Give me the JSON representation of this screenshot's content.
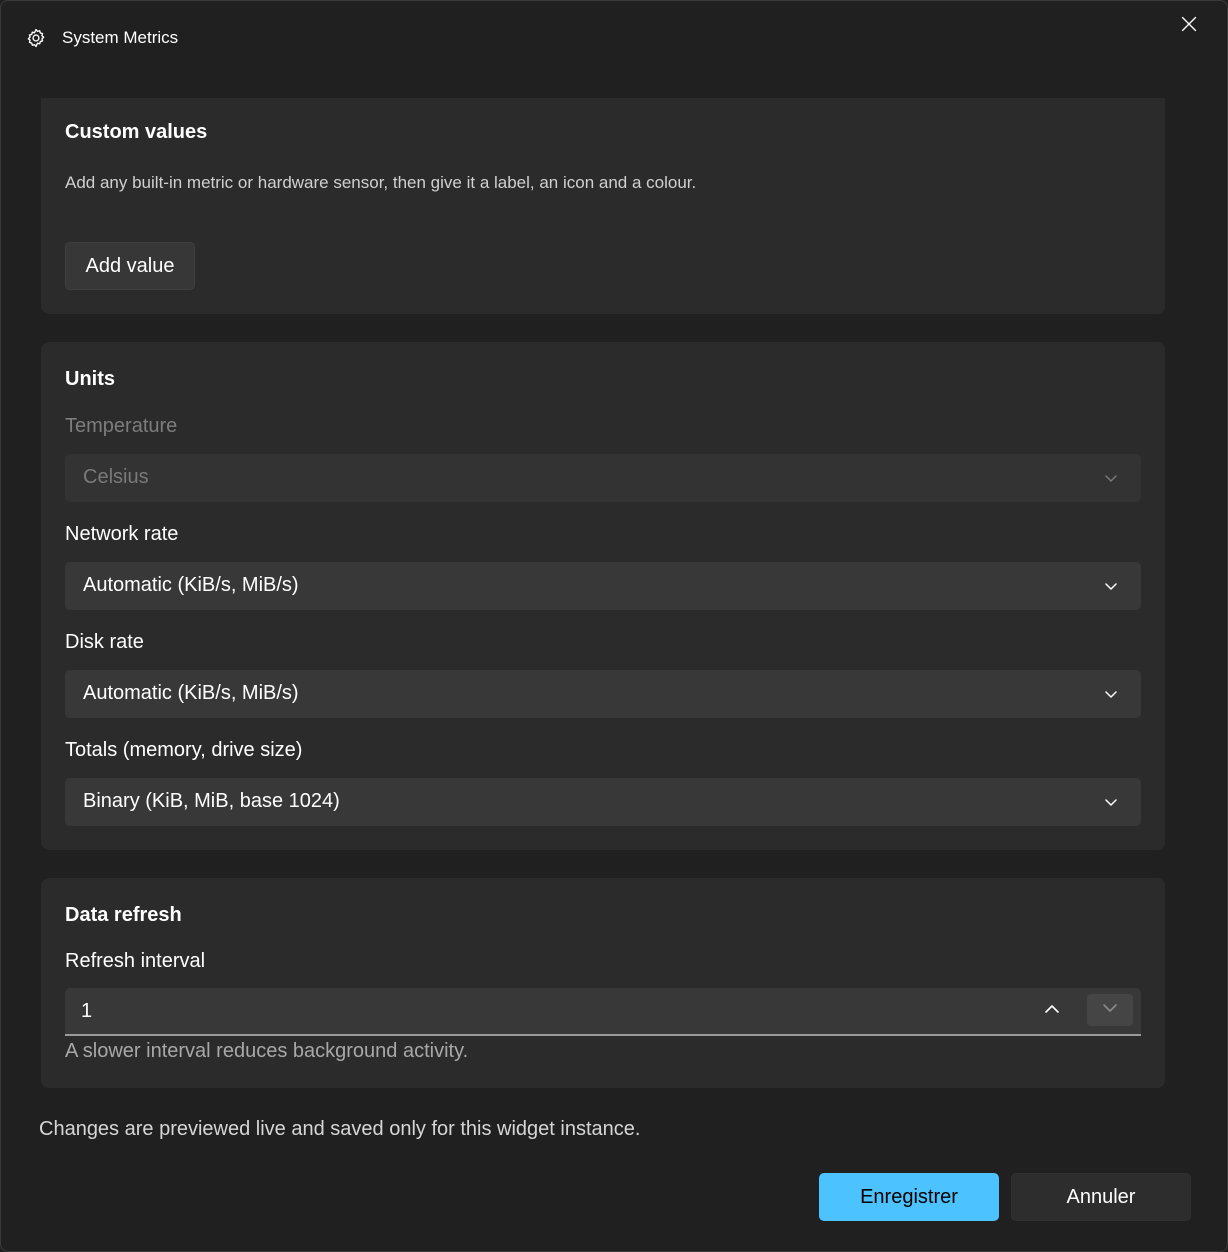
{
  "window": {
    "title": "System Metrics",
    "title_icon": "gear-icon",
    "close_icon": "close-icon"
  },
  "custom_values": {
    "title": "Custom values",
    "description": "Add any built-in metric or hardware sensor, then give it a label, an icon and a colour.",
    "add_button": "Add value"
  },
  "units": {
    "title": "Units",
    "temperature": {
      "label": "Temperature",
      "value": "Celsius",
      "disabled": true
    },
    "network_rate": {
      "label": "Network rate",
      "value": "Automatic (KiB/s, MiB/s)"
    },
    "disk_rate": {
      "label": "Disk rate",
      "value": "Automatic (KiB/s, MiB/s)"
    },
    "totals": {
      "label": "Totals (memory, drive size)",
      "value": "Binary (KiB, MiB, base 1024)"
    }
  },
  "data_refresh": {
    "title": "Data refresh",
    "interval_label": "Refresh interval",
    "interval_value": "1",
    "helper": "A slower interval reduces background activity."
  },
  "footer": {
    "note": "Changes are previewed live and saved only for this widget instance.",
    "save_button": "Enregistrer",
    "cancel_button": "Annuler"
  },
  "colors": {
    "accent": "#4cc2ff",
    "background": "#202020",
    "card": "#2b2b2b",
    "control": "#383838"
  }
}
